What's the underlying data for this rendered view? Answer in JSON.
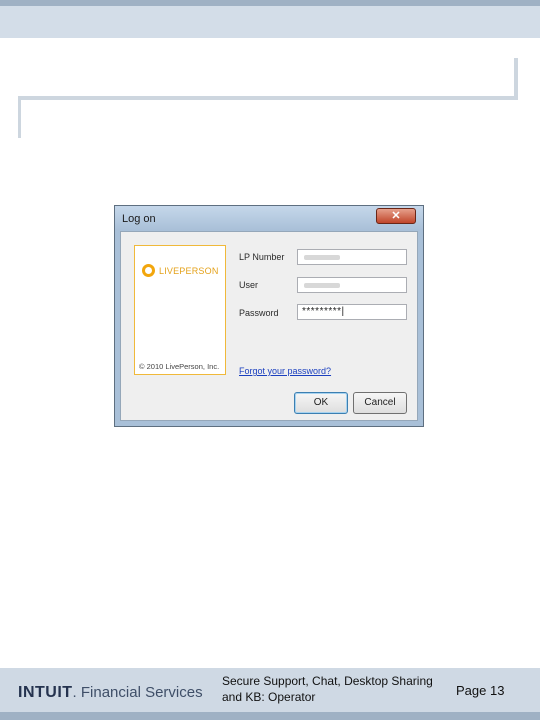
{
  "dialog": {
    "title": "Log on",
    "close_label": "✕",
    "logo_text": "LIVEPERSON",
    "copyright": "© 2010 LivePerson, Inc.",
    "fields": [
      {
        "label": "LP Number",
        "value": ""
      },
      {
        "label": "User",
        "value": ""
      },
      {
        "label": "Password",
        "value": "*********|"
      }
    ],
    "forgot_link": "Forgot your password?",
    "ok_label": "OK",
    "cancel_label": "Cancel"
  },
  "footer": {
    "brand_strong": "INTUIT",
    "brand_rest": ". Financial Services",
    "title": "Secure Support, Chat, Desktop Sharing and KB: Operator",
    "page": "Page 13"
  },
  "colors": {
    "accent_orange": "#f2a60d",
    "link_blue": "#1a3fbf",
    "close_red": "#c0452a"
  },
  "icons": {
    "close": "close-icon",
    "logo": "liveperson-logo-icon"
  }
}
